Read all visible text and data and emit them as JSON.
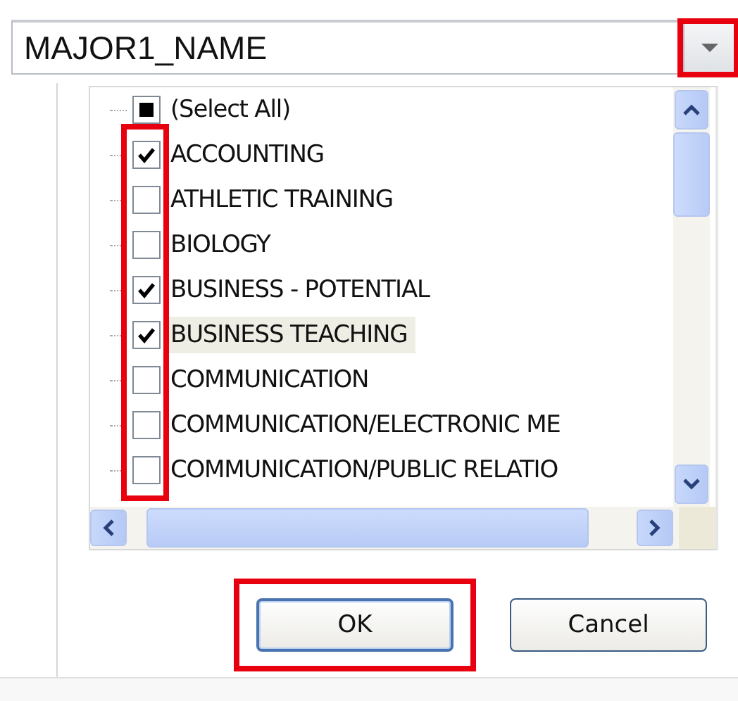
{
  "field_selector": {
    "value": "MAJOR1_NAME",
    "highlighted": true
  },
  "select_all": {
    "label": "(Select All)",
    "mixed": true
  },
  "items": [
    {
      "label": "ACCOUNTING",
      "checked": true,
      "hovered": false
    },
    {
      "label": "ATHLETIC TRAINING",
      "checked": false,
      "hovered": false
    },
    {
      "label": "BIOLOGY",
      "checked": false,
      "hovered": false
    },
    {
      "label": "BUSINESS - POTENTIAL",
      "checked": true,
      "hovered": false
    },
    {
      "label": "BUSINESS TEACHING",
      "checked": true,
      "hovered": true
    },
    {
      "label": "COMMUNICATION",
      "checked": false,
      "hovered": false
    },
    {
      "label": "COMMUNICATION/ELECTRONIC ME",
      "checked": false,
      "hovered": false
    },
    {
      "label": "COMMUNICATION/PUBLIC RELATIO",
      "checked": false,
      "hovered": false
    }
  ],
  "checkboxes_highlighted": true,
  "buttons": [
    {
      "label": "OK",
      "default": true,
      "highlighted": true
    },
    {
      "label": "Cancel",
      "default": false,
      "highlighted": false
    }
  ]
}
